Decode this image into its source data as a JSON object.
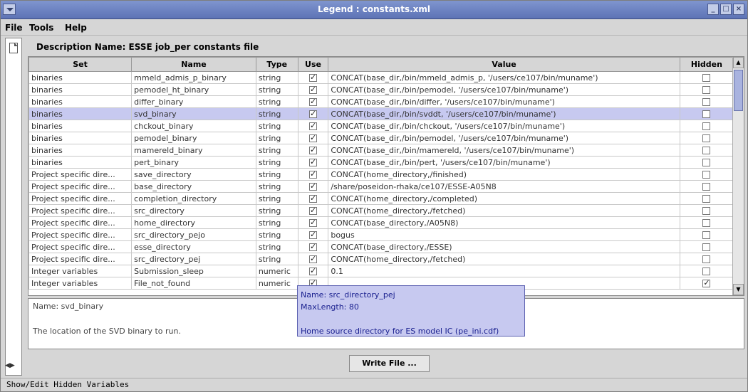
{
  "window": {
    "title": "Legend : constants.xml"
  },
  "menu": {
    "file": "File",
    "tools": "Tools",
    "help": "Help"
  },
  "description_label": "Description Name: ESSE job_per constants file",
  "table": {
    "columns": [
      "Set",
      "Name",
      "Type",
      "Use",
      "Value",
      "Hidden"
    ],
    "rows": [
      {
        "set": "binaries",
        "name": "mmeld_admis_p_binary",
        "type": "string",
        "use": true,
        "value": "CONCAT(base_dir,/bin/mmeld_admis_p, '/users/ce107/bin/muname')",
        "hidden": false
      },
      {
        "set": "binaries",
        "name": "pemodel_ht_binary",
        "type": "string",
        "use": true,
        "value": "CONCAT(base_dir,/bin/pemodel, '/users/ce107/bin/muname')",
        "hidden": false
      },
      {
        "set": "binaries",
        "name": "differ_binary",
        "type": "string",
        "use": true,
        "value": "CONCAT(base_dir,/bin/differ, '/users/ce107/bin/muname')",
        "hidden": false
      },
      {
        "set": "binaries",
        "name": "svd_binary",
        "type": "string",
        "use": true,
        "value": "CONCAT(base_dir,/bin/svddt, '/users/ce107/bin/muname')",
        "hidden": false,
        "selected": true
      },
      {
        "set": "binaries",
        "name": "chckout_binary",
        "type": "string",
        "use": true,
        "value": "CONCAT(base_dir,/bin/chckout, '/users/ce107/bin/muname')",
        "hidden": false
      },
      {
        "set": "binaries",
        "name": "pemodel_binary",
        "type": "string",
        "use": true,
        "value": "CONCAT(base_dir,/bin/pemodel, '/users/ce107/bin/muname')",
        "hidden": false
      },
      {
        "set": "binaries",
        "name": "mamereld_binary",
        "type": "string",
        "use": true,
        "value": "CONCAT(base_dir,/bin/mamereld, '/users/ce107/bin/muname')",
        "hidden": false
      },
      {
        "set": "binaries",
        "name": "pert_binary",
        "type": "string",
        "use": true,
        "value": "CONCAT(base_dir,/bin/pert, '/users/ce107/bin/muname')",
        "hidden": false
      },
      {
        "set": "Project specific dire...",
        "name": "save_directory",
        "type": "string",
        "use": true,
        "value": "CONCAT(home_directory,/finished)",
        "hidden": false
      },
      {
        "set": "Project specific dire...",
        "name": "base_directory",
        "type": "string",
        "use": true,
        "value": "/share/poseidon-rhaka/ce107/ESSE-A05N8",
        "hidden": false
      },
      {
        "set": "Project specific dire...",
        "name": "completion_directory",
        "type": "string",
        "use": true,
        "value": "CONCAT(home_directory,/completed)",
        "hidden": false
      },
      {
        "set": "Project specific dire...",
        "name": "src_directory",
        "type": "string",
        "use": true,
        "value": "CONCAT(home_directory,/fetched)",
        "hidden": false
      },
      {
        "set": "Project specific dire...",
        "name": "home_directory",
        "type": "string",
        "use": true,
        "value": "CONCAT(base_directory,/A05N8)",
        "hidden": false
      },
      {
        "set": "Project specific dire...",
        "name": "src_directory_pejo",
        "type": "string",
        "use": true,
        "value": "bogus",
        "hidden": false
      },
      {
        "set": "Project specific dire...",
        "name": "esse_directory",
        "type": "string",
        "use": true,
        "value": "CONCAT(base_directory,/ESSE)",
        "hidden": false
      },
      {
        "set": "Project specific dire...",
        "name": "src_directory_pej",
        "type": "string",
        "use": true,
        "value": "CONCAT(home_directory,/fetched)",
        "hidden": false
      },
      {
        "set": "Integer variables",
        "name": "Submission_sleep",
        "type": "numeric",
        "use": true,
        "value": "0.1",
        "hidden": false
      },
      {
        "set": "Integer variables",
        "name": "File_not_found",
        "type": "numeric",
        "use": true,
        "value": "",
        "hidden": true
      }
    ]
  },
  "tooltip": {
    "line1": "Name: src_directory_pej",
    "line2": "MaxLength: 80",
    "line3": "Home source directory for ES model IC (pe_ini.cdf)"
  },
  "info": {
    "name_line": "Name: svd_binary",
    "desc_line": "The location of the SVD binary to run."
  },
  "write_button": "Write File ...",
  "status": "Show/Edit Hidden Variables",
  "colors": {
    "selection": "#c7c9f0",
    "titlebar": "#6f85c4"
  }
}
